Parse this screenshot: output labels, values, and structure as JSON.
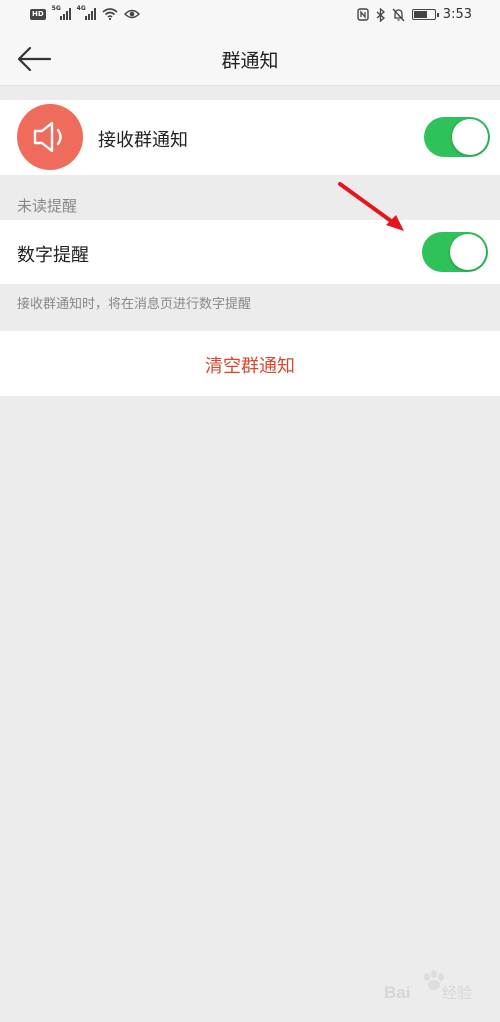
{
  "status_bar": {
    "network_1": "5G",
    "network_2": "4G",
    "hd_badge": "HD",
    "time": "3:53",
    "icons": [
      "hd-icon",
      "signal-icon",
      "signal-icon",
      "wifi-icon",
      "eye-icon",
      "nfc-icon",
      "bluetooth-icon",
      "mute-bell-icon",
      "battery-icon"
    ]
  },
  "header": {
    "title": "群通知",
    "back_icon": "arrow-left-icon"
  },
  "receive_row": {
    "label": "接收群通知",
    "icon": "speaker-icon",
    "icon_bg_color": "#ef6b5b",
    "toggle_on": true
  },
  "unread_section": {
    "label": "未读提醒"
  },
  "digit_row": {
    "label": "数字提醒",
    "toggle_on": true,
    "hint": "接收群通知时，将在消息页进行数字提醒"
  },
  "clear_button": {
    "label": "清空群通知",
    "color": "#d9472f"
  },
  "colors": {
    "toggle_on": "#2fc25b",
    "background": "#ececec",
    "annotation_arrow": "#e8141c"
  },
  "watermark": {
    "text": "Bai经验"
  }
}
